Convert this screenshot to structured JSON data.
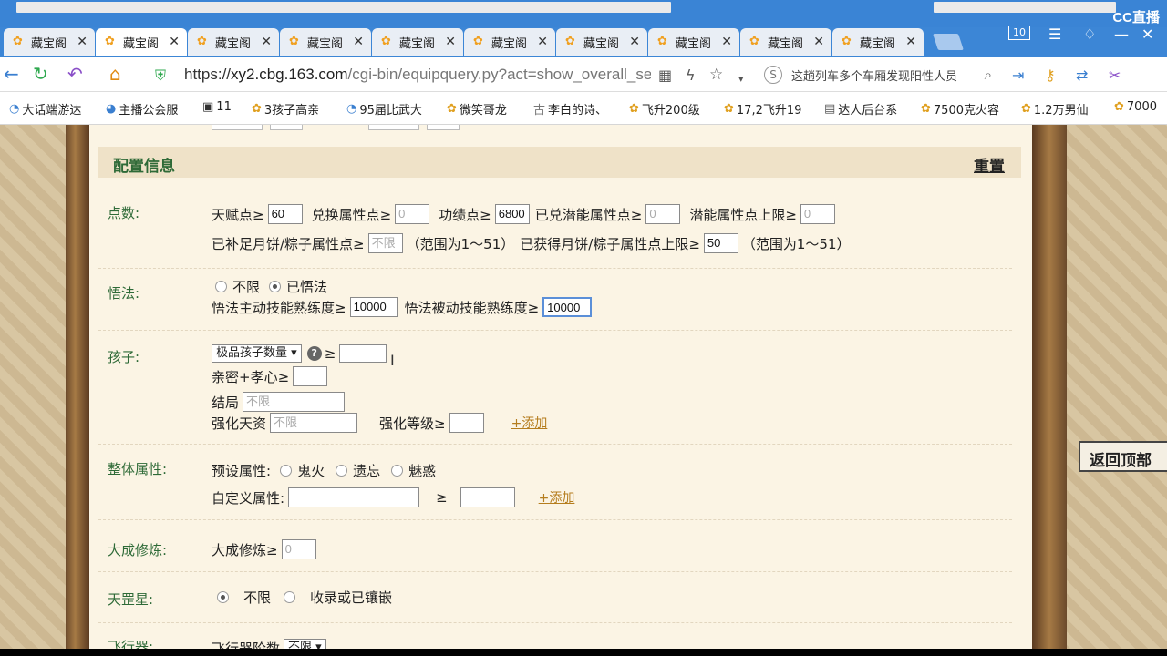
{
  "browser": {
    "brand": "CC直播",
    "tab_count": "10",
    "tabs": [
      {
        "label": "藏宝阁",
        "active": false
      },
      {
        "label": "藏宝阁",
        "active": true
      },
      {
        "label": "藏宝阁",
        "active": false
      },
      {
        "label": "藏宝阁",
        "active": false
      },
      {
        "label": "藏宝阁",
        "active": false
      },
      {
        "label": "藏宝阁",
        "active": false
      },
      {
        "label": "藏宝阁",
        "active": false
      },
      {
        "label": "藏宝阁",
        "active": false
      },
      {
        "label": "藏宝阁",
        "active": false
      },
      {
        "label": "藏宝阁",
        "active": false
      }
    ],
    "url_scheme": "https://",
    "url_host": "xy2.cbg.163.com",
    "url_path": "/cgi-bin/equipquery.py?act=show_overall_se",
    "search_text": "这趟列车多个车厢发现阳性人员",
    "bookmarks": [
      "大话端游达",
      "主播公会服",
      "11",
      "3孩子高亲",
      "95届比武大",
      "微笑哥龙",
      "李白的诗、",
      "飞升200级",
      "17,2飞升19",
      "达人后台系",
      "7500克火容",
      "1.2万男仙",
      "7000"
    ]
  },
  "config": {
    "title": "配置信息",
    "reset": "重置",
    "points": {
      "label": "点数:",
      "talent_label": "天赋点≥",
      "talent_value": "60",
      "exchange_label": "兑换属性点≥",
      "exchange_value": "0",
      "merit_label": "功绩点≥",
      "merit_value": "6800",
      "potential_ex_label": "已兑潜能属性点≥",
      "potential_ex_value": "0",
      "potential_cap_label": "潜能属性点上限≥",
      "potential_cap_value": "0",
      "mooncake_label": "已补足月饼/粽子属性点≥",
      "mooncake_placeholder": "不限",
      "range1": "（范围为1～51）",
      "mooncake_cap_label": "已获得月饼/粽子属性点上限≥",
      "mooncake_cap_value": "50",
      "range2": "（范围为1～51）"
    },
    "enlighten": {
      "label": "悟法:",
      "opt_any": "不限",
      "opt_done": "已悟法",
      "active_label": "悟法主动技能熟练度≥",
      "active_value": "10000",
      "passive_label": "悟法被动技能熟练度≥",
      "passive_value": "10000"
    },
    "child": {
      "label": "孩子:",
      "select_value": "极品孩子数量",
      "help": "?",
      "ge": "≥",
      "intimacy_label": "亲密+孝心≥",
      "ending_label": "结局",
      "ending_placeholder": "不限",
      "talent_label": "强化天资",
      "talent_placeholder": "不限",
      "level_label": "强化等级≥",
      "add": "+添加"
    },
    "overall": {
      "label": "整体属性:",
      "preset_label": "预设属性:",
      "opt1": "鬼火",
      "opt2": "遗忘",
      "opt3": "魅惑",
      "custom_label": "自定义属性:",
      "ge": "≥",
      "add": "+添加"
    },
    "dacheng": {
      "label": "大成修炼:",
      "field_label": "大成修炼≥",
      "placeholder": "0"
    },
    "tiangang": {
      "label": "天罡星:",
      "opt_any": "不限",
      "opt_collect": "收录或已镶嵌"
    },
    "feixing": {
      "label": "飞行器:",
      "field_label": "飞行器阶数",
      "select_value": "不限"
    }
  },
  "back_to_top": "返回顶部"
}
